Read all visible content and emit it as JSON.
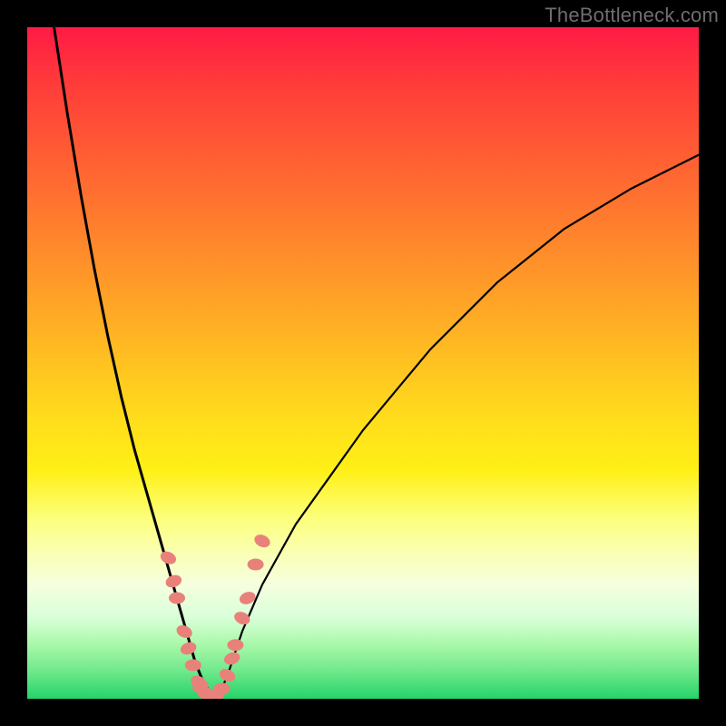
{
  "watermark": "TheBottleneck.com",
  "colors": {
    "background": "#000000",
    "curve": "#000000",
    "marker_fill": "#e9817b",
    "marker_stroke": "#d96e68"
  },
  "chart_data": {
    "type": "line",
    "title": "",
    "xlabel": "",
    "ylabel": "",
    "xlim": [
      0,
      100
    ],
    "ylim": [
      0,
      100
    ],
    "grid": false,
    "legend": false,
    "note": "Qualitative bottleneck V-curve; no axis tick labels shown in source image. Values estimated from pixel positions: y=0 is optimal (green), y=100 is worst (red).",
    "series": [
      {
        "name": "left-branch",
        "x": [
          4,
          6,
          8,
          10,
          12,
          14,
          16,
          18,
          20,
          22,
          24,
          25,
          26,
          27,
          28
        ],
        "y": [
          100,
          87,
          75,
          64,
          54,
          45,
          37,
          30,
          23,
          16,
          9,
          5.5,
          3,
          1.2,
          0
        ]
      },
      {
        "name": "right-branch",
        "x": [
          28,
          29,
          30,
          31,
          32,
          35,
          40,
          45,
          50,
          55,
          60,
          65,
          70,
          75,
          80,
          85,
          90,
          95,
          100
        ],
        "y": [
          0,
          1.5,
          4,
          7,
          10,
          17,
          26,
          33,
          40,
          46,
          52,
          57,
          62,
          66,
          70,
          73,
          76,
          78.5,
          81
        ]
      },
      {
        "name": "valley-markers",
        "type": "scatter",
        "x": [
          21.0,
          21.8,
          22.3,
          23.4,
          24.0,
          24.7,
          25.5,
          25.8,
          26.6,
          27.4,
          28.2,
          29.0,
          29.8,
          30.5,
          31.0,
          32.0,
          32.8,
          34.0,
          35.0
        ],
        "y": [
          21.0,
          17.5,
          15.0,
          10.0,
          7.5,
          5.0,
          2.5,
          1.8,
          0.8,
          0.3,
          0.5,
          1.5,
          3.5,
          6.0,
          8.0,
          12.0,
          15.0,
          20.0,
          23.5
        ]
      }
    ]
  }
}
